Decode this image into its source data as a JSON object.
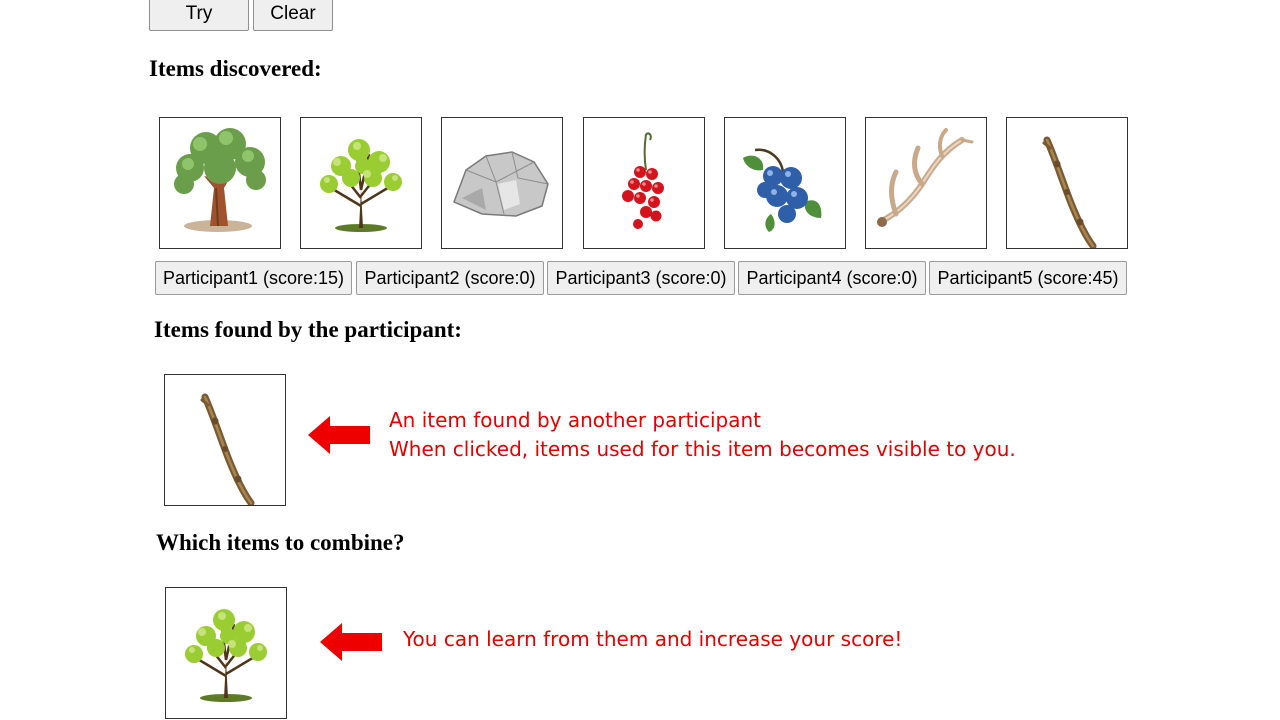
{
  "controls": {
    "try_label": "Try",
    "clear_label": "Clear"
  },
  "items_discovered": {
    "heading": "Items discovered:",
    "items": [
      {
        "name": "oak-tree-icon"
      },
      {
        "name": "young-tree-icon"
      },
      {
        "name": "rock-icon"
      },
      {
        "name": "red-currants-icon"
      },
      {
        "name": "blueberries-icon"
      },
      {
        "name": "antler-icon"
      },
      {
        "name": "stick-icon"
      }
    ]
  },
  "participants": [
    {
      "label": "Participant1 (score:15)"
    },
    {
      "label": "Participant2 (score:0)"
    },
    {
      "label": "Participant3 (score:0)"
    },
    {
      "label": "Participant4 (score:0)"
    },
    {
      "label": "Participant5 (score:45)"
    }
  ],
  "participant_items": {
    "heading": "Items found by the participant:",
    "annotation_line1": "An item found by another participant",
    "annotation_line2": "When clicked, items used for this item becomes visible to you."
  },
  "combine": {
    "heading": "Which items to combine?",
    "annotation": "You can learn from them and increase your score!"
  },
  "colors": {
    "annotation": "#e60000",
    "button_bg": "#efefef"
  }
}
